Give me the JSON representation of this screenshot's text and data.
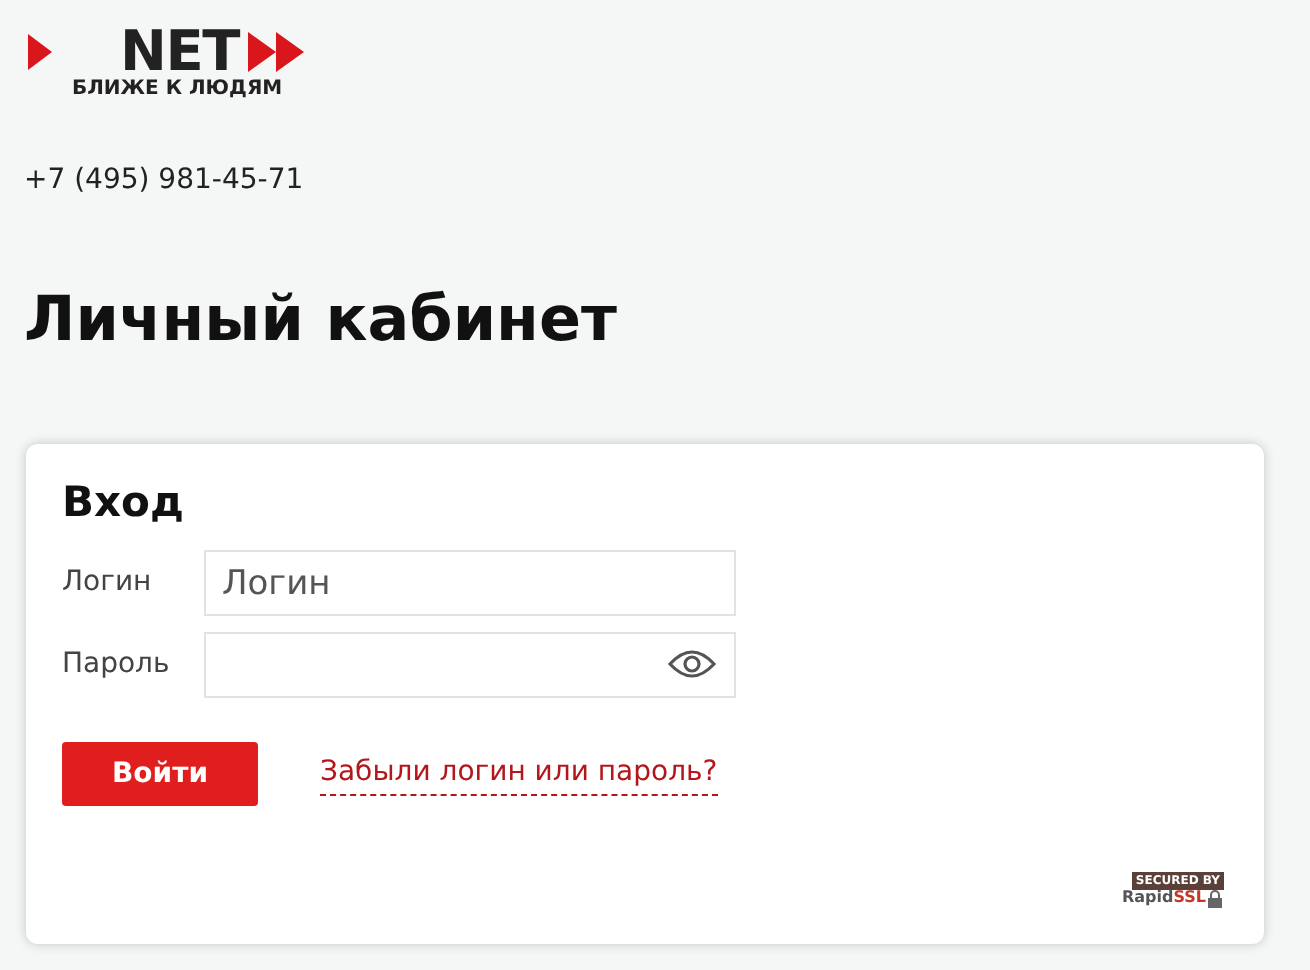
{
  "header": {
    "logo_text": "NET",
    "tagline": "БЛИЖЕ К ЛЮДЯМ",
    "phone": "+7 (495) 981-45-71"
  },
  "page_title": "Личный кабинет",
  "login_card": {
    "title": "Вход",
    "fields": [
      {
        "label": "Логин",
        "placeholder": "Логин",
        "kind": "text"
      },
      {
        "label": "Пароль",
        "kind": "password"
      }
    ],
    "submit": "Войти",
    "forgot_link": "Забыли логин или пароль?",
    "ssl_badge": {
      "top": "SECURED BY",
      "brand": "Rapid",
      "brand_accent": "SSL"
    }
  }
}
